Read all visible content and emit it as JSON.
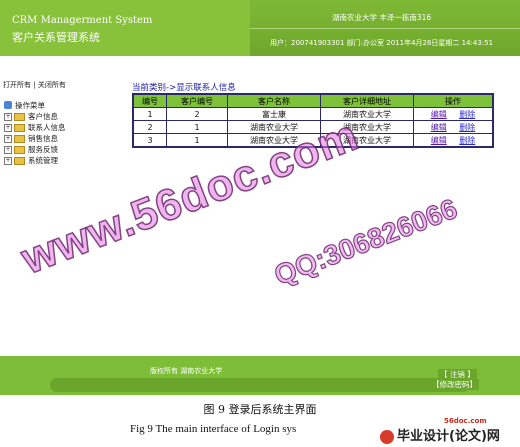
{
  "header": {
    "system_en": "CRM Managerment System",
    "system_cn": "客户关系管理系统",
    "university": "湖南农业大学  丰泽一栋南316",
    "user_line": "用户：200741903301  部门:办公室  2011年4月26日星期二  14:43:51"
  },
  "sidebar": {
    "expand_all": "打开所有",
    "separator": "|",
    "collapse_all": "关闭所有",
    "root": "操作菜单",
    "items": [
      {
        "label": "客户信息"
      },
      {
        "label": "联系人信息"
      },
      {
        "label": "销售信息"
      },
      {
        "label": "服务反馈"
      },
      {
        "label": "系统管理"
      }
    ]
  },
  "main": {
    "breadcrumb": "当前类别->显示联系人信息",
    "columns": [
      "编号",
      "客户编号",
      "客户名称",
      "客户详细地址",
      "操作"
    ],
    "rows": [
      {
        "id": "1",
        "customer_id": "2",
        "name": "富士康",
        "address": "湖南农业大学",
        "edit": "编辑",
        "delete": "删除"
      },
      {
        "id": "2",
        "customer_id": "1",
        "name": "湖南农业大学",
        "address": "湖南农业大学",
        "edit": "编辑",
        "delete": "删除"
      },
      {
        "id": "3",
        "customer_id": "1",
        "name": "湖南农业大学",
        "address": "湖南农业大学",
        "edit": "编辑",
        "delete": "删除"
      }
    ]
  },
  "footer": {
    "copyright": "版权所有 湖南农业大学",
    "logout": "【 注销 】",
    "change_password": "【修改密码】"
  },
  "watermark": {
    "site": "www.56doc.com",
    "qq": "QQ:306826066"
  },
  "caption": {
    "cn": "图 9    登录后系统主界面",
    "en": "Fig 9    The main interface of Login sys",
    "site_small": "56doc.com",
    "site_brand": "毕业设计(论文)网"
  }
}
